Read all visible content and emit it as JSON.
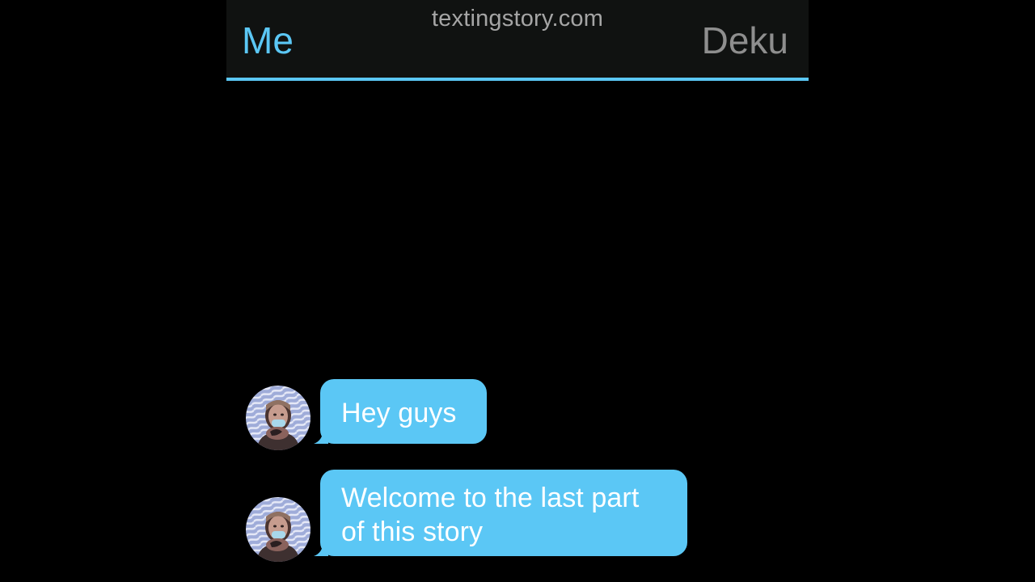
{
  "watermark": "textingstory.com",
  "header": {
    "sender_name": "Me",
    "recipient_name": "Deku"
  },
  "messages": [
    {
      "text": "Hey guys",
      "avatar_icon": "profile-photo-avatar"
    },
    {
      "text": "Welcome to the last part of this story",
      "avatar_icon": "profile-photo-avatar"
    }
  ],
  "colors": {
    "accent": "#5bc7f5",
    "header_background": "#101211",
    "background": "#000000",
    "watermark": "#a5a5a5",
    "recipient": "#8e8e8e",
    "message_text": "#ffffff"
  }
}
